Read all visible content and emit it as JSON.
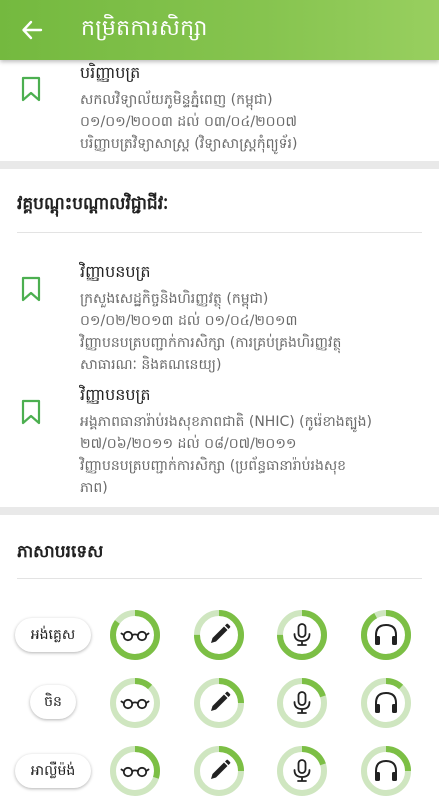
{
  "app_bar": {
    "title": "កម្រិតការសិក្សា"
  },
  "education_top": {
    "title": "បរិញ្ញាបត្រ",
    "lines": [
      "សកលវិទ្យាល័យភូមិន្ទភ្នំពេញ (កម្ពុជា)",
      "០១/០១/២០០៣ ដល់ ០៣/០៤/២០០៧",
      "បរិញ្ញាបត្រវិទ្យាសាស្ត្រ (វិទ្យាសាស្ត្រកុំព្យូទ័រ)"
    ]
  },
  "training": {
    "title": "វគ្គបណ្តុះបណ្តាលវិជ្ជាជីវៈ",
    "items": [
      {
        "title": "វិញ្ញាបនបត្រ",
        "lines": [
          "ក្រសួងសេដ្ឋកិច្ចនិងហិរញ្ញវត្ថុ (កម្ពុជា)",
          "០១/០២/២០១៣ ដល់ ០១/០៤/២០១៣",
          "វិញ្ញាបនបត្របញ្ជាក់ការសិក្សា (ការគ្រប់គ្រងហិរញ្ញវត្ថុ",
          "សាធារណៈ និងគណនេយ្យ)"
        ]
      },
      {
        "title": "វិញ្ញាបនបត្រ",
        "lines": [
          "អង្គភាពធានារ៉ាប់រងសុខភាពជាតិ (NHIC) (កូរ៉េខាងត្បូង)",
          "២៧/០៦/២០១១ ដល់ ០៨/០៧/២០១១",
          "វិញ្ញាបនបត្របញ្ជាក់ការសិក្សា (ប្រព័ន្ធធានារ៉ាប់រងសុខ",
          "ភាព)"
        ]
      }
    ]
  },
  "languages": {
    "title": "ភាសាបរទេស",
    "rows": [
      {
        "name": "អង់គ្លេស",
        "levels": [
          0.85,
          0.75,
          0.75,
          0.92
        ]
      },
      {
        "name": "ចិន",
        "levels": [
          0.12,
          0.25,
          0.2,
          0.12
        ]
      },
      {
        "name": "អាល្លឺម៉ង់",
        "levels": [
          0.3,
          0.25,
          0.2,
          0.25
        ]
      }
    ]
  },
  "colors": {
    "accent": "#7cbf45",
    "ring_track": "#cfe6c0",
    "bookmark": "#4caf50"
  },
  "icons": [
    "back-arrow-icon",
    "bookmark-icon",
    "glasses-icon",
    "pen-icon",
    "microphone-icon",
    "headphones-icon"
  ]
}
